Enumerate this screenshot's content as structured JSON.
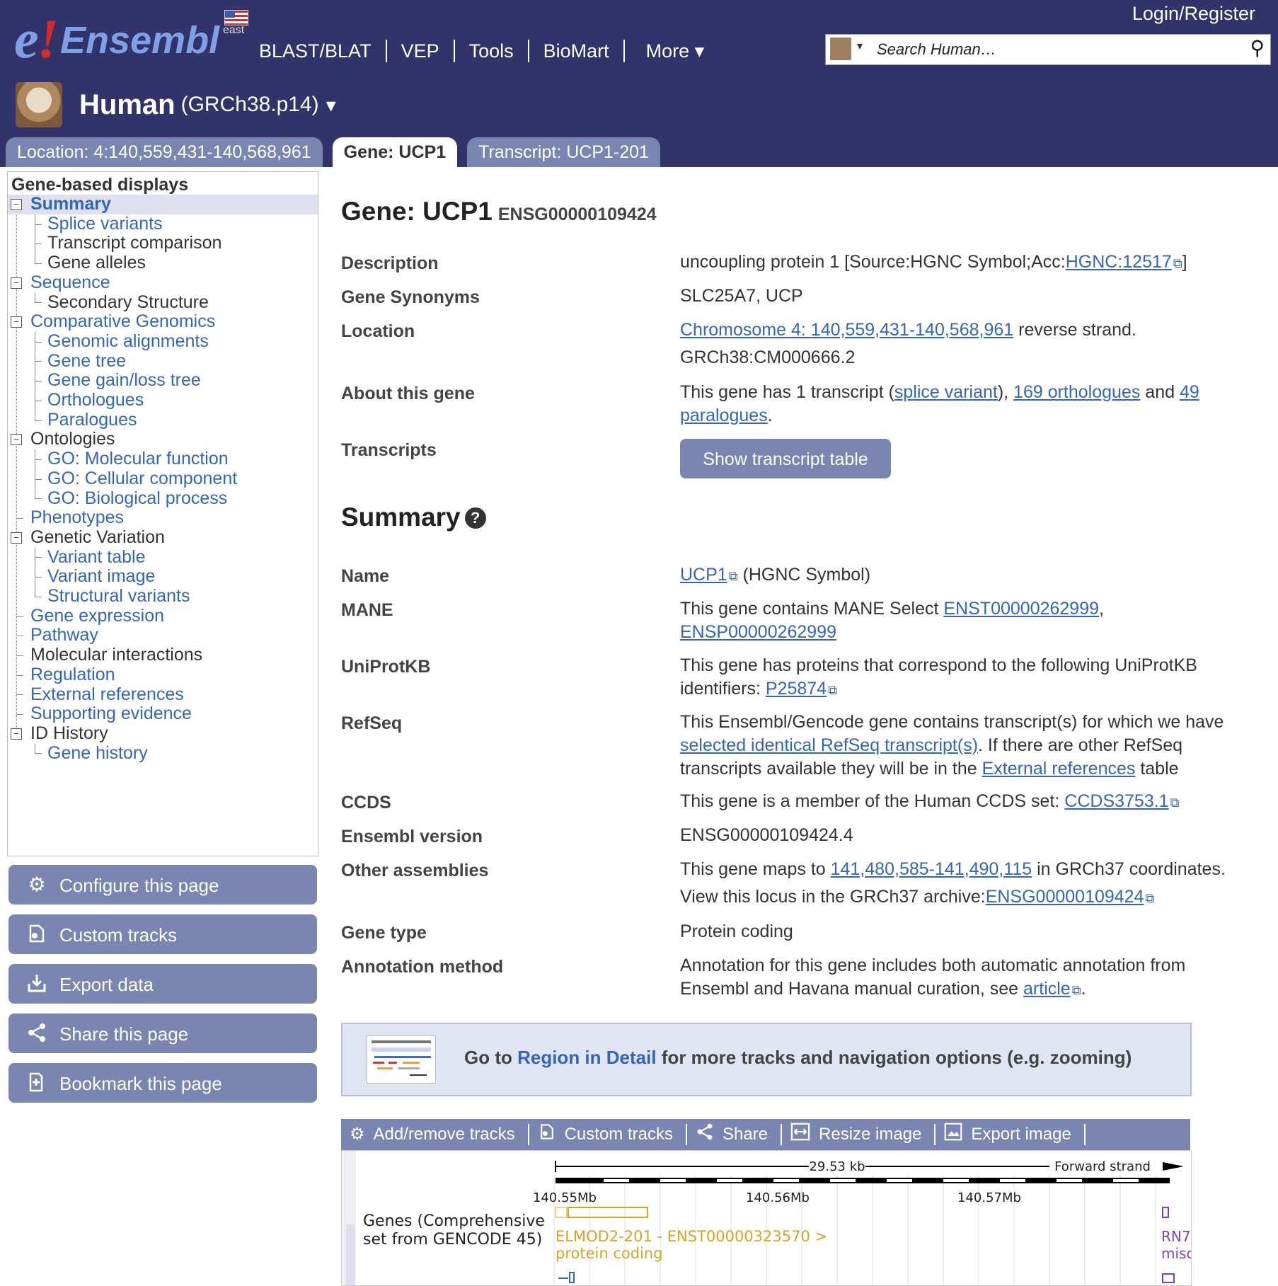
{
  "header": {
    "logo_text": "e!Ensembl",
    "region_label": "east",
    "nav": [
      "BLAST/BLAT",
      "VEP",
      "Tools",
      "BioMart",
      "More ▾"
    ],
    "login": "Login/Register",
    "search_placeholder": "Search Human…",
    "species": "Human",
    "assembly": "(GRCh38.p14)",
    "species_dropdown": "▾"
  },
  "tabs": [
    {
      "label": "Location: 4:140,559,431-140,568,961",
      "active": false
    },
    {
      "label": "Gene: UCP1",
      "active": true
    },
    {
      "label": "Transcript: UCP1-201",
      "active": false
    }
  ],
  "sidebar": {
    "heading": "Gene-based displays",
    "items": [
      {
        "label": "Summary",
        "link": true,
        "level": 0,
        "box": "-"
      },
      {
        "label": "Splice variants",
        "link": true,
        "level": 1
      },
      {
        "label": "Transcript comparison",
        "link": false,
        "level": 1
      },
      {
        "label": "Gene alleles",
        "link": false,
        "level": 1
      },
      {
        "label": "Sequence",
        "link": true,
        "level": 0,
        "box": "-"
      },
      {
        "label": "Secondary Structure",
        "link": false,
        "level": 1
      },
      {
        "label": "Comparative Genomics",
        "link": true,
        "level": 0,
        "box": "-"
      },
      {
        "label": "Genomic alignments",
        "link": true,
        "level": 1
      },
      {
        "label": "Gene tree",
        "link": true,
        "level": 1
      },
      {
        "label": "Gene gain/loss tree",
        "link": true,
        "level": 1
      },
      {
        "label": "Orthologues",
        "link": true,
        "level": 1
      },
      {
        "label": "Paralogues",
        "link": true,
        "level": 1
      },
      {
        "label": "Ontologies",
        "link": false,
        "level": 0,
        "box": "-"
      },
      {
        "label": "GO: Molecular function",
        "link": true,
        "level": 1
      },
      {
        "label": "GO: Cellular component",
        "link": true,
        "level": 1
      },
      {
        "label": "GO: Biological process",
        "link": true,
        "level": 1
      },
      {
        "label": "Phenotypes",
        "link": true,
        "level": 0
      },
      {
        "label": "Genetic Variation",
        "link": false,
        "level": 0,
        "box": "-"
      },
      {
        "label": "Variant table",
        "link": true,
        "level": 1
      },
      {
        "label": "Variant image",
        "link": true,
        "level": 1
      },
      {
        "label": "Structural variants",
        "link": true,
        "level": 1
      },
      {
        "label": "Gene expression",
        "link": true,
        "level": 0
      },
      {
        "label": "Pathway",
        "link": true,
        "level": 0
      },
      {
        "label": "Molecular interactions",
        "link": false,
        "level": 0
      },
      {
        "label": "Regulation",
        "link": true,
        "level": 0
      },
      {
        "label": "External references",
        "link": true,
        "level": 0
      },
      {
        "label": "Supporting evidence",
        "link": true,
        "level": 0
      },
      {
        "label": "ID History",
        "link": false,
        "level": 0,
        "box": "-"
      },
      {
        "label": "Gene history",
        "link": true,
        "level": 1
      }
    ],
    "buttons": [
      {
        "label": "Configure this page",
        "icon": "gear-icon"
      },
      {
        "label": "Custom tracks",
        "icon": "custom-tracks-icon"
      },
      {
        "label": "Export data",
        "icon": "export-icon"
      },
      {
        "label": "Share this page",
        "icon": "share-icon"
      },
      {
        "label": "Bookmark this page",
        "icon": "bookmark-icon"
      }
    ]
  },
  "gene": {
    "title": "Gene: UCP1",
    "stable_id": "ENSG00000109424",
    "description_label": "Description",
    "description_text": "uncoupling protein 1 [Source:HGNC Symbol;Acc:",
    "description_link": "HGNC:12517",
    "description_end": "]",
    "synonyms_label": "Gene Synonyms",
    "synonyms": "SLC25A7, UCP",
    "location_label": "Location",
    "location_link": "Chromosome 4: 140,559,431-140,568,961",
    "location_strand": " reverse strand.",
    "location_seq": "GRCh38:CM000666.2",
    "about_label": "About this gene",
    "about_1": "This gene has 1 transcript (",
    "about_link1": "splice variant",
    "about_2": "), ",
    "about_link2": "169 orthologues",
    "about_3": " and ",
    "about_link3a": "49",
    "about_link3b": "paralogues",
    "about_4": ".",
    "transcripts_label": "Transcripts",
    "show_table_button": "Show transcript table"
  },
  "summary": {
    "heading": "Summary",
    "help_icon": "?",
    "name_label": "Name",
    "name_link": "UCP1",
    "name_rest": " (HGNC Symbol)",
    "mane_label": "MANE",
    "mane_text": "This gene contains MANE Select ",
    "mane_link1": "ENST00000262999",
    "mane_comma": ",",
    "mane_link2": "ENSP00000262999",
    "uniprot_label": "UniProtKB",
    "uniprot_text1": "This gene has proteins that correspond to the following UniProtKB",
    "uniprot_text2": "identifiers: ",
    "uniprot_link": "P25874",
    "refseq_label": "RefSeq",
    "refseq_text1": "This Ensembl/Gencode gene contains transcript(s) for which we have",
    "refseq_link1": "selected identical RefSeq transcript(s)",
    "refseq_text2": ". If there are other RefSeq",
    "refseq_text3": "transcripts available they will be in the ",
    "refseq_link2": "External references",
    "refseq_text4": " table",
    "ccds_label": "CCDS",
    "ccds_text": "This gene is a member of the Human CCDS set: ",
    "ccds_link": "CCDS3753.1",
    "version_label": "Ensembl version",
    "version": "ENSG00000109424.4",
    "other_label": "Other assemblies",
    "other_text1": "This gene maps to ",
    "other_link1": "141,480,585-141,490,115",
    "other_text2": " in GRCh37 coordinates.",
    "other_text3": "View this locus in the GRCh37 archive: ",
    "other_link2": "ENSG00000109424",
    "type_label": "Gene type",
    "type": "Protein coding",
    "annot_label": "Annotation method",
    "annot_text1": "Annotation for this gene includes both automatic annotation from",
    "annot_text2": "Ensembl and Havana manual curation, see ",
    "annot_link": "article",
    "annot_end": "."
  },
  "region_box": {
    "pre": "Go to ",
    "link": "Region in Detail",
    "post": " for more tracks and navigation options (e.g. zooming)"
  },
  "image_toolbar": [
    {
      "label": "Add/remove tracks",
      "icon": "gear-icon"
    },
    {
      "label": "Custom tracks",
      "icon": "custom-tracks-icon"
    },
    {
      "label": "Share",
      "icon": "share-icon"
    },
    {
      "label": "Resize image",
      "icon": "resize-icon"
    },
    {
      "label": "Export image",
      "icon": "export-image-icon"
    }
  ],
  "genome_image": {
    "scale_label": "29.53 kb",
    "strand_label": "Forward strand",
    "ticks": [
      "140.55Mb",
      "140.56Mb",
      "140.57Mb"
    ],
    "track_label_1": "Genes (Comprehensive",
    "track_label_2": "set from GENCODE 45)",
    "gene_label": "ELMOD2-201 - ENST00000323570 >",
    "biotype": "protein coding",
    "right_label_1": "RN7",
    "right_label_2": "misc"
  }
}
